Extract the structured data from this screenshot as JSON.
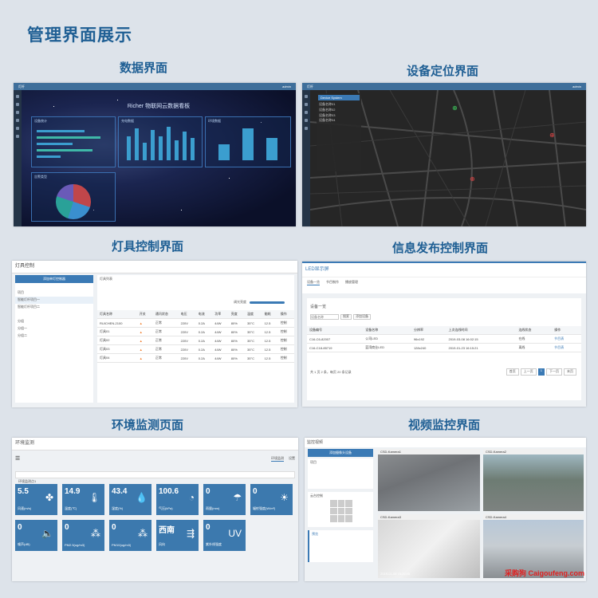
{
  "page": {
    "title": "管理界面展示"
  },
  "sections": {
    "data": "数据界面",
    "location": "设备定位界面",
    "lighting": "灯具控制界面",
    "info": "信息发布控制界面",
    "env": "环境监测页面",
    "video": "视频监控界面"
  },
  "topbar": {
    "brand": "灯杆",
    "user": "admin"
  },
  "dashboard": {
    "title": "Richer 物联网云数据看板",
    "cards": [
      "设备统计",
      "充电数据",
      "环境数据",
      "告警类型"
    ]
  },
  "map": {
    "selector": "Device System",
    "devices": [
      "设备名称01",
      "设备名称02",
      "设备名称03",
      "设备名称04"
    ]
  },
  "lighting": {
    "header": "灯具控制",
    "add_button": "添加单灯控制器",
    "group_label": "项目",
    "group_items": [
      "智能灯杆项目一",
      "智能灯杆项目二"
    ],
    "sub_label": "分组",
    "sub_items": [
      "分组一",
      "分组二"
    ],
    "list_title": "灯具列表",
    "slider_label": "调光亮度",
    "columns": [
      "灯具名称",
      "开关",
      "通讯状态",
      "电压",
      "电流",
      "功率",
      "亮度",
      "温度",
      "能耗",
      "操作"
    ],
    "rows": [
      [
        "RUICHEN-2100",
        "",
        "正常",
        "220V",
        "0.2A",
        "44W",
        "80%",
        "35°C",
        "12.5",
        "控制"
      ],
      [
        "灯具01",
        "",
        "正常",
        "220V",
        "0.2A",
        "44W",
        "80%",
        "35°C",
        "12.5",
        "控制"
      ],
      [
        "灯具02",
        "",
        "正常",
        "220V",
        "0.2A",
        "44W",
        "80%",
        "35°C",
        "12.5",
        "控制"
      ],
      [
        "灯具03",
        "",
        "正常",
        "220V",
        "0.2A",
        "44W",
        "80%",
        "35°C",
        "12.5",
        "控制"
      ],
      [
        "灯具04",
        "",
        "正常",
        "220V",
        "0.2A",
        "44W",
        "80%",
        "35°C",
        "12.5",
        "控制"
      ]
    ]
  },
  "led": {
    "header": "LED显示屏",
    "tabs": [
      "设备一览",
      "节目制作",
      "播放管理"
    ],
    "list_title": "设备一览",
    "search_placeholder": "设备名称",
    "search_btn": "搜索",
    "add_btn": "添加设备",
    "columns": [
      "设备编号",
      "设备名称",
      "分辨率",
      "上次连线时间",
      "连线状态",
      "操作"
    ],
    "rows": [
      [
        "C16-C6-82007",
        "公司LED",
        "96x192",
        "2019-03-08 16:02:15",
        "在线",
        "节目表"
      ],
      [
        "C16-C18-85719",
        "蓝湾商业LED",
        "128x240",
        "2019-01-23 16:15:21",
        "离线",
        "节目表"
      ]
    ],
    "footer": "共 1 页 2 条，每页 20 条记录",
    "pager": [
      "首页",
      "上一页",
      "1",
      "下一页",
      "末页"
    ]
  },
  "env": {
    "header": "环境监测",
    "tabs": [
      "环境监测",
      "设置"
    ],
    "select": "环境监测点1",
    "tiles": [
      {
        "value": "5.5",
        "label": "风速(m/s)",
        "icon": "fan-icon",
        "glyph": "✤"
      },
      {
        "value": "14.9",
        "label": "温度(℃)",
        "icon": "thermometer-icon",
        "glyph": "🌡"
      },
      {
        "value": "43.4",
        "label": "湿度(%)",
        "icon": "drop-icon",
        "glyph": "💧"
      },
      {
        "value": "100.6",
        "label": "气压(kPa)",
        "icon": "gauge-icon",
        "glyph": "◔"
      },
      {
        "value": "0",
        "label": "雨量(mm)",
        "icon": "rain-icon",
        "glyph": "☂"
      },
      {
        "value": "0",
        "label": "辐射强度(W/m²)",
        "icon": "sun-icon",
        "glyph": "☀"
      },
      {
        "value": "0",
        "label": "噪声(dB)",
        "icon": "speaker-icon",
        "glyph": "🔈"
      },
      {
        "value": "0",
        "label": "PM2.5(ug/m3)",
        "icon": "pm25-icon",
        "glyph": "⁂"
      },
      {
        "value": "0",
        "label": "PM10(ug/m3)",
        "icon": "pm10-icon",
        "glyph": "⁂"
      },
      {
        "value": "西南",
        "label": "风向",
        "icon": "wind-icon",
        "glyph": "⇶"
      },
      {
        "value": "0",
        "label": "紫外线强度",
        "icon": "uv-icon",
        "glyph": "UV"
      }
    ]
  },
  "video": {
    "header": "监控视频",
    "add_btn": "添加摄像头设备",
    "project_label": "项目",
    "ptz_label": "云台控制",
    "preview_label": "预览",
    "cams": [
      "CSD-Kamera1",
      "CSD-Kamera2",
      "CSD-Kamera3",
      "CSD-Kamera4"
    ],
    "timestamp": "2019-01-08 15:26:05"
  },
  "watermark": {
    "text": "采购狗 Caigoufeng.com"
  }
}
